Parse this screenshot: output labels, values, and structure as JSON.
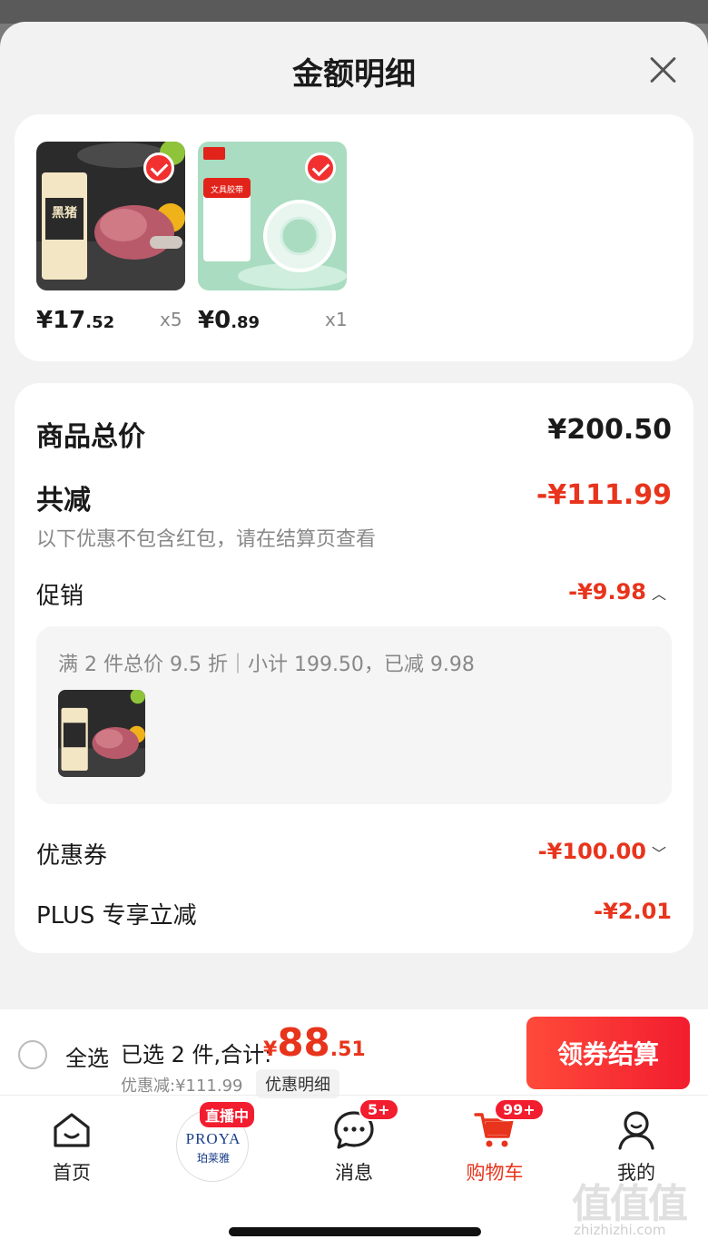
{
  "sheet": {
    "title": "金额明细"
  },
  "items": [
    {
      "price_int": "¥17",
      "price_dec": ".52",
      "qty": "x5",
      "product_label": "黑猪"
    },
    {
      "price_int": "¥0",
      "price_dec": ".89",
      "qty": "x1",
      "product_label": "文具胶带"
    }
  ],
  "breakdown": {
    "total_label": "商品总价",
    "total_value": "¥200.50",
    "reduce_label": "共减",
    "reduce_value": "-¥111.99",
    "note": "以下优惠不包含红包，请在结算页查看",
    "promo_label": "促销",
    "promo_value": "-¥9.98",
    "promo_detail": "满 2 件总价 9.5 折｜小计 199.50，已减 9.98",
    "coupon_label": "优惠券",
    "coupon_value": "-¥100.00",
    "plus_label": "PLUS 专享立减",
    "plus_value": "-¥2.01"
  },
  "footer": {
    "select_all": "全选",
    "summary": "已选 2 件,合计:",
    "total_yen": "¥",
    "total_int": "88",
    "total_dec": ".51",
    "discount": "优惠减:¥111.99",
    "detail_tag": "优惠明细",
    "checkout": "领券结算"
  },
  "nav": {
    "home": "首页",
    "live_badge": "直播中",
    "live_brand": "PROYA",
    "live_brand_cn": "珀莱雅",
    "messages": "消息",
    "messages_badge": "5+",
    "cart": "购物车",
    "cart_badge": "99+",
    "me": "我的"
  },
  "watermark": {
    "text": "值值值",
    "url": "zhizhizhi.com"
  },
  "colors": {
    "accent": "#e8341c",
    "button": "#f21d2f"
  }
}
